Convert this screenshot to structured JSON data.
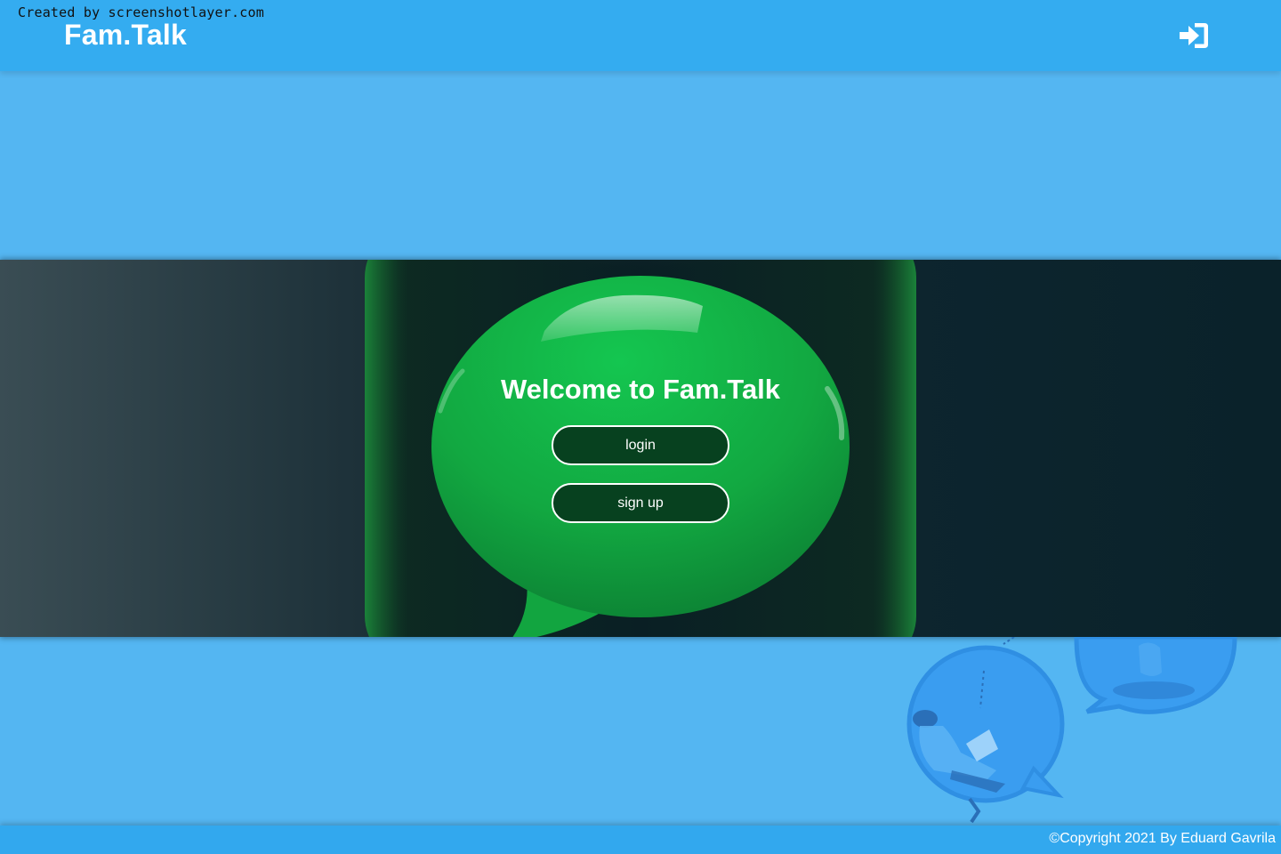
{
  "watermark": "Created by screenshotlayer.com",
  "navbar": {
    "brand": "Fam.Talk",
    "login_icon": "sign-in-icon"
  },
  "hero": {
    "title": "Welcome to Fam.Talk",
    "login_label": "login",
    "signup_label": "sign up",
    "background_image": "green-speech-bubble-3d"
  },
  "illustration": "people-in-blue-speech-bubbles",
  "footer": {
    "copyright": "©Copyright 2021 By Eduard Gavrila"
  },
  "colors": {
    "navbar": "#34acf0",
    "page_background": "#54b6f2",
    "button_fill": "#07411f",
    "bubble_green": "#17b34a",
    "footer": "#32a8ee"
  }
}
